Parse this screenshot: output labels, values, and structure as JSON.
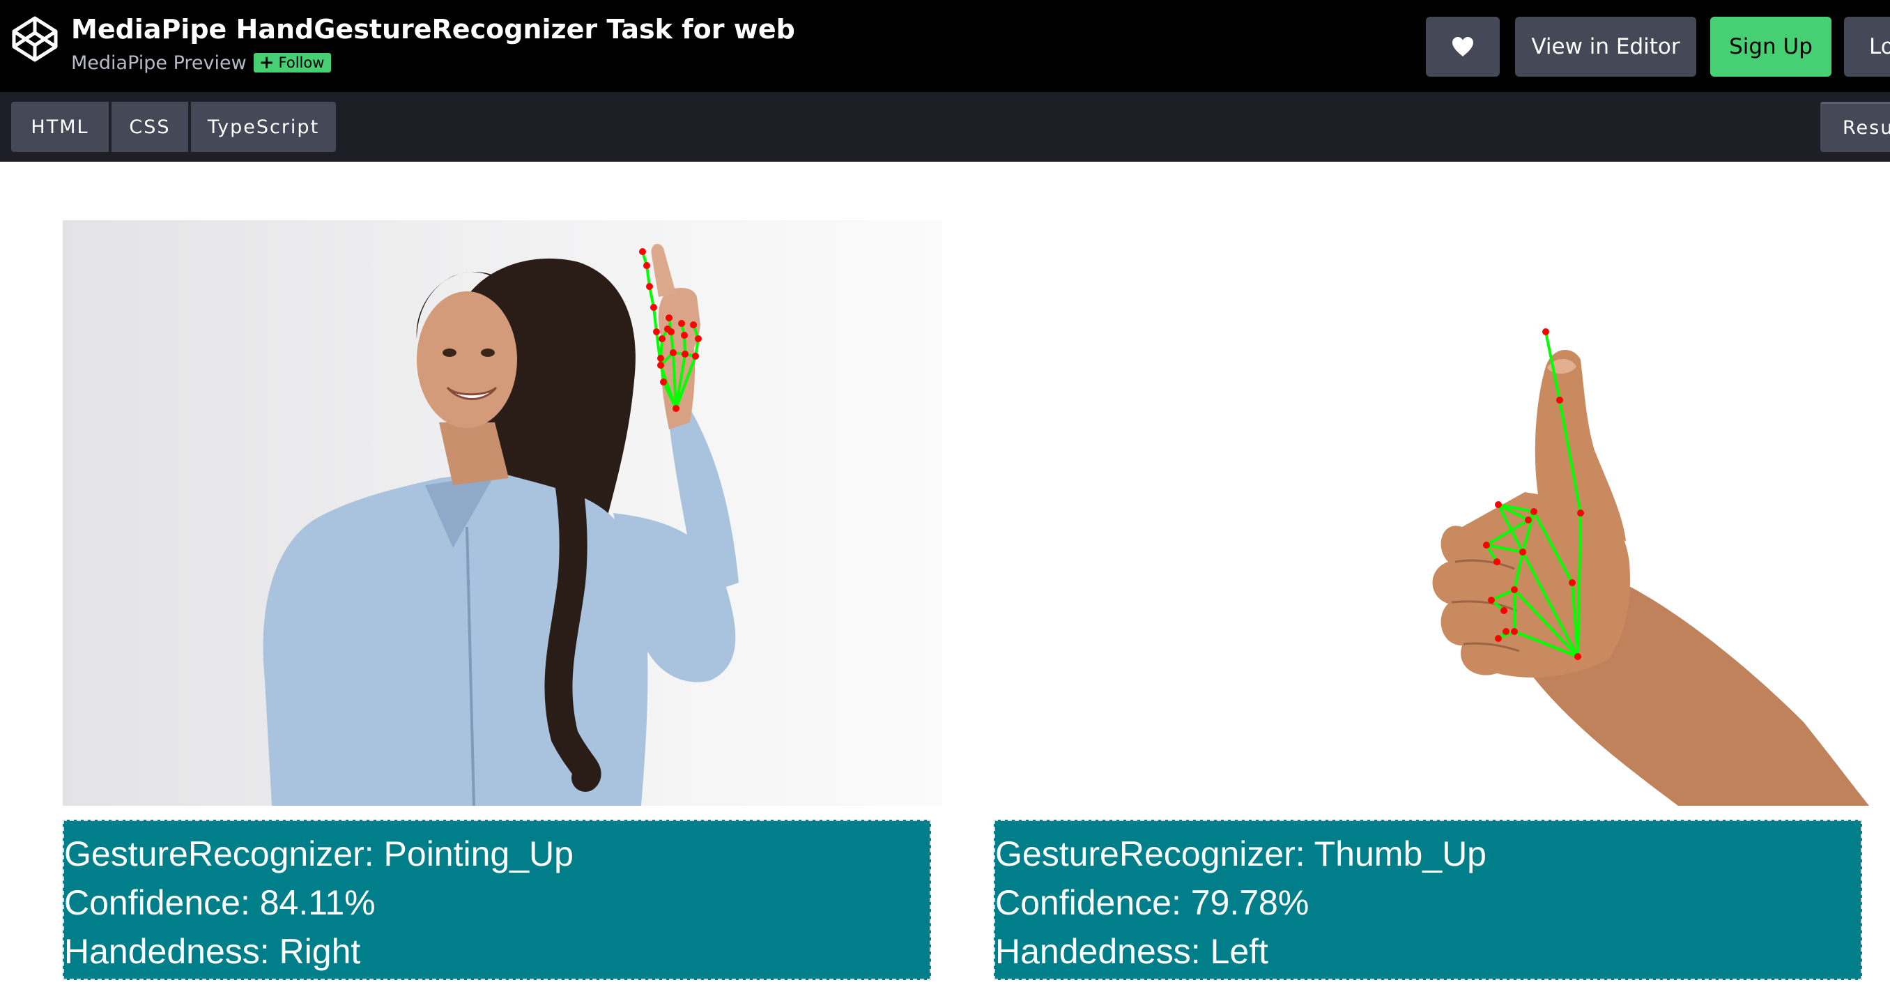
{
  "header": {
    "title": "MediaPipe HandGestureRecognizer Task for web",
    "owner": "MediaPipe Preview",
    "follow_label": "Follow",
    "buttons": {
      "heart_icon": "heart-icon",
      "view_in_editor": "View in Editor",
      "sign_up": "Sign Up",
      "log_in": "Lo"
    }
  },
  "tabs": {
    "html": "HTML",
    "css": "CSS",
    "typescript": "TypeScript",
    "result": "Resul"
  },
  "results": [
    {
      "image": "woman pointing up with hand landmarks",
      "lines": [
        "GestureRecognizer: Pointing_Up",
        "Confidence: 84.11%",
        "Handedness: Right"
      ]
    },
    {
      "image": "thumbs up hand with hand landmarks",
      "lines": [
        "GestureRecognizer: Thumb_Up",
        "Confidence: 79.78%",
        "Handedness: Left"
      ]
    }
  ],
  "colors": {
    "header_bg": "#000000",
    "tabbar_bg": "#1e1f26",
    "button_bg": "#444857",
    "signup_green": "#47cf73",
    "result_panel": "#007f8b",
    "landmark_line": "#00ff00",
    "landmark_point": "#ff0000"
  }
}
